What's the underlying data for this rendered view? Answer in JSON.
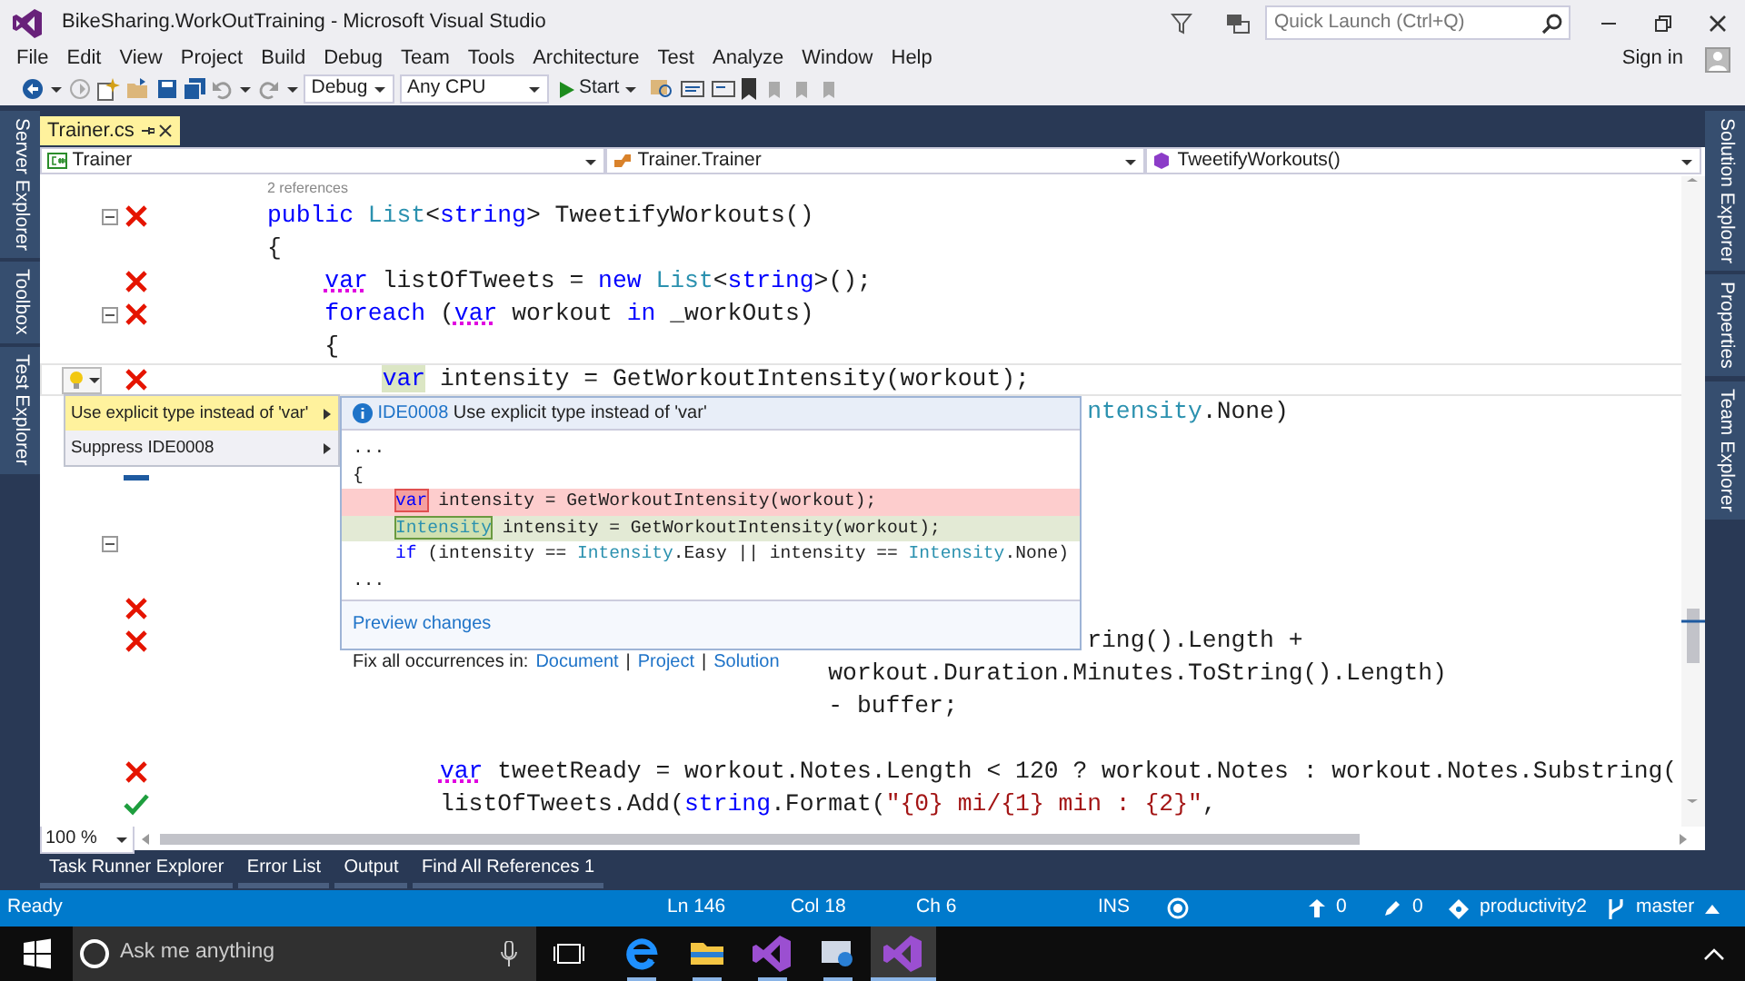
{
  "window": {
    "title": "BikeSharing.WorkOutTraining - Microsoft Visual Studio"
  },
  "quick_launch": {
    "placeholder": "Quick Launch (Ctrl+Q)"
  },
  "menu": [
    "File",
    "Edit",
    "View",
    "Project",
    "Build",
    "Debug",
    "Team",
    "Tools",
    "Architecture",
    "Test",
    "Analyze",
    "Window",
    "Help"
  ],
  "sign_in": "Sign in",
  "toolbar": {
    "configuration": "Debug",
    "platform": "Any CPU",
    "start": "Start"
  },
  "left_tool_tabs": [
    "Server Explorer",
    "Toolbox",
    "Test Explorer"
  ],
  "right_tool_tabs": [
    "Solution Explorer",
    "Properties",
    "Team Explorer"
  ],
  "document_tabs": [
    {
      "label": "Trainer.cs",
      "selected": true
    }
  ],
  "navigation_bar": [
    {
      "kind": "class",
      "text": "Trainer"
    },
    {
      "kind": "type",
      "text": "Trainer.Trainer"
    },
    {
      "kind": "method",
      "text": "TweetifyWorkouts()"
    }
  ],
  "editor": {
    "codelens": "2 references",
    "zoom": "100 %",
    "lines": [
      {
        "kind": "error",
        "fold": true,
        "current": false,
        "tokens": [
          {
            "kind": "kw",
            "text": "public"
          },
          {
            "kind": "type",
            "text": " List"
          },
          {
            "kind": "plain",
            "text": "<"
          },
          {
            "kind": "kw",
            "text": "string"
          },
          {
            "kind": "plain",
            "text": "> TweetifyWorkouts()"
          }
        ]
      },
      {
        "kind": "none",
        "fold": false,
        "current": false,
        "tokens": [
          {
            "kind": "plain",
            "text": "{"
          }
        ]
      },
      {
        "kind": "error",
        "fold": false,
        "current": false,
        "tokens": [
          {
            "kind": "kw_squiggle",
            "text": "    var"
          },
          {
            "kind": "plain",
            "text": " listOfTweets = "
          },
          {
            "kind": "kw",
            "text": "new"
          },
          {
            "kind": "type",
            "text": " List"
          },
          {
            "kind": "plain",
            "text": "<"
          },
          {
            "kind": "kw",
            "text": "string"
          },
          {
            "kind": "plain",
            "text": ">();"
          }
        ]
      },
      {
        "kind": "error",
        "fold": true,
        "current": false,
        "tokens": [
          {
            "kind": "kw",
            "text": "    foreach"
          },
          {
            "kind": "plain",
            "text": " ("
          },
          {
            "kind": "kw_squiggle",
            "text": "var"
          },
          {
            "kind": "plain",
            "text": " workout "
          },
          {
            "kind": "kw",
            "text": "in"
          },
          {
            "kind": "plain",
            "text": " _workOuts)"
          }
        ]
      },
      {
        "kind": "none",
        "fold": false,
        "current": false,
        "tokens": [
          {
            "kind": "plain",
            "text": "    {"
          }
        ]
      },
      {
        "kind": "error",
        "fold": false,
        "current": true,
        "tokens": [
          {
            "kind": "kw_ref",
            "text": "        var"
          },
          {
            "kind": "plain",
            "text": " intensity = GetWorkoutIntensity(workout);"
          }
        ]
      },
      {
        "kind": "none",
        "fold": false,
        "current": false,
        "tokens": [
          {
            "kind": "type",
            "text": "                                                         ntensity"
          },
          {
            "kind": "plain",
            "text": ".None)"
          }
        ]
      },
      {
        "kind": "none",
        "fold": false,
        "current": false
      },
      {
        "kind": "change",
        "fold": false,
        "current": false
      },
      {
        "kind": "none",
        "fold": false,
        "current": false
      },
      {
        "kind": "none",
        "fold": true,
        "current": false
      },
      {
        "kind": "none",
        "fold": false,
        "current": false
      },
      {
        "kind": "error",
        "fold": false,
        "current": false
      },
      {
        "kind": "error",
        "fold": false,
        "current": false,
        "tokens": [
          {
            "kind": "plain",
            "text": "                                                         ring().Length +"
          }
        ]
      },
      {
        "kind": "none",
        "fold": false,
        "current": false,
        "tokens": [
          {
            "kind": "plain",
            "text": "                                       workout.Duration.Minutes.ToString().Length)"
          }
        ]
      },
      {
        "kind": "none",
        "fold": false,
        "current": false,
        "tokens": [
          {
            "kind": "plain",
            "text": "                                       - buffer;"
          }
        ]
      },
      {
        "kind": "none",
        "fold": false,
        "current": false
      },
      {
        "kind": "error",
        "fold": false,
        "current": false,
        "tokens": [
          {
            "kind": "kw_squiggle",
            "text": "            var"
          },
          {
            "kind": "plain",
            "text": " tweetReady = workout.Notes.Length < 120 ? workout.Notes : workout.Notes.Substring("
          }
        ]
      },
      {
        "kind": "check",
        "fold": false,
        "current": false,
        "tokens": [
          {
            "kind": "plain",
            "text": "            listOfTweets.Add("
          },
          {
            "kind": "kw",
            "text": "string"
          },
          {
            "kind": "plain",
            "text": ".Format("
          },
          {
            "kind": "str",
            "text": "\"{0} mi/{1} min : {2}\""
          },
          {
            "kind": "plain",
            "text": ","
          }
        ]
      }
    ]
  },
  "quick_actions": {
    "items": [
      {
        "label": "Use explicit type instead of 'var'",
        "selected": true
      },
      {
        "label": "Suppress IDE0008",
        "selected": false
      }
    ],
    "preview": {
      "code": "IDE0008",
      "message": "Use explicit type instead of 'var'",
      "lines": [
        {
          "kind": "context",
          "tokens": [
            {
              "kind": "plain",
              "text": "..."
            }
          ]
        },
        {
          "kind": "context",
          "tokens": [
            {
              "kind": "plain",
              "text": "{"
            }
          ]
        },
        {
          "kind": "removed",
          "tokens": [
            {
              "kind": "kw_del",
              "text": "    var"
            },
            {
              "kind": "plain",
              "text": " intensity = GetWorkoutIntensity(workout);"
            }
          ]
        },
        {
          "kind": "added",
          "tokens": [
            {
              "kind": "type_add",
              "text": "    Intensity"
            },
            {
              "kind": "plain",
              "text": " intensity = GetWorkoutIntensity(workout);"
            }
          ]
        },
        {
          "kind": "context",
          "tokens": [
            {
              "kind": "kw",
              "text": "    if"
            },
            {
              "kind": "plain",
              "text": " (intensity == "
            },
            {
              "kind": "type",
              "text": "Intensity"
            },
            {
              "kind": "plain",
              "text": ".Easy || intensity == "
            },
            {
              "kind": "type",
              "text": "Intensity"
            },
            {
              "kind": "plain",
              "text": ".None)"
            }
          ]
        },
        {
          "kind": "context",
          "tokens": [
            {
              "kind": "plain",
              "text": "..."
            }
          ]
        }
      ],
      "preview_link": "Preview changes",
      "fix_all_label": "Fix all occurrences in:",
      "fix_all_scopes": [
        "Document",
        "Project",
        "Solution"
      ],
      "separator": "|"
    }
  },
  "bottom_tabs": [
    "Task Runner Explorer",
    "Error List",
    "Output",
    "Find All References 1"
  ],
  "status_bar": {
    "state": "Ready",
    "line": "Ln 146",
    "column": "Col 18",
    "char": "Ch 6",
    "mode": "INS",
    "pushes": "0",
    "edits": "0",
    "repository": "productivity2",
    "branch": "master"
  },
  "taskbar": {
    "search_placeholder": "Ask me anything"
  }
}
